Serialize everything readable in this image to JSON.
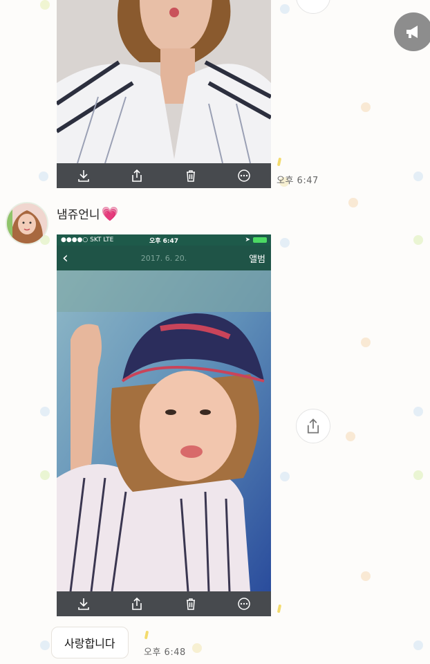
{
  "messages": [
    {
      "type": "photo",
      "time": "오후 6:47"
    },
    {
      "sender": "냄쥬언니",
      "sender_emoji": "💗",
      "type": "screenshot",
      "status_bar": {
        "carrier": "●●●●○ SKT  LTE",
        "time": "오후 6:47"
      },
      "nav": {
        "back": "‹",
        "date": "2017. 6. 20.",
        "album": "앨범"
      }
    },
    {
      "type": "text",
      "text": "사랑합니다",
      "time": "오후 6:48"
    }
  ],
  "icons": {
    "toolbar": [
      "download-icon",
      "share-icon",
      "trash-icon",
      "more-icon"
    ],
    "float": [
      "share-icon",
      "megaphone-icon"
    ]
  },
  "colors": {
    "toolbar": "#3c3e42",
    "heart": "#e8529a",
    "nav": "#1f5447",
    "battery": "#4cd964"
  }
}
